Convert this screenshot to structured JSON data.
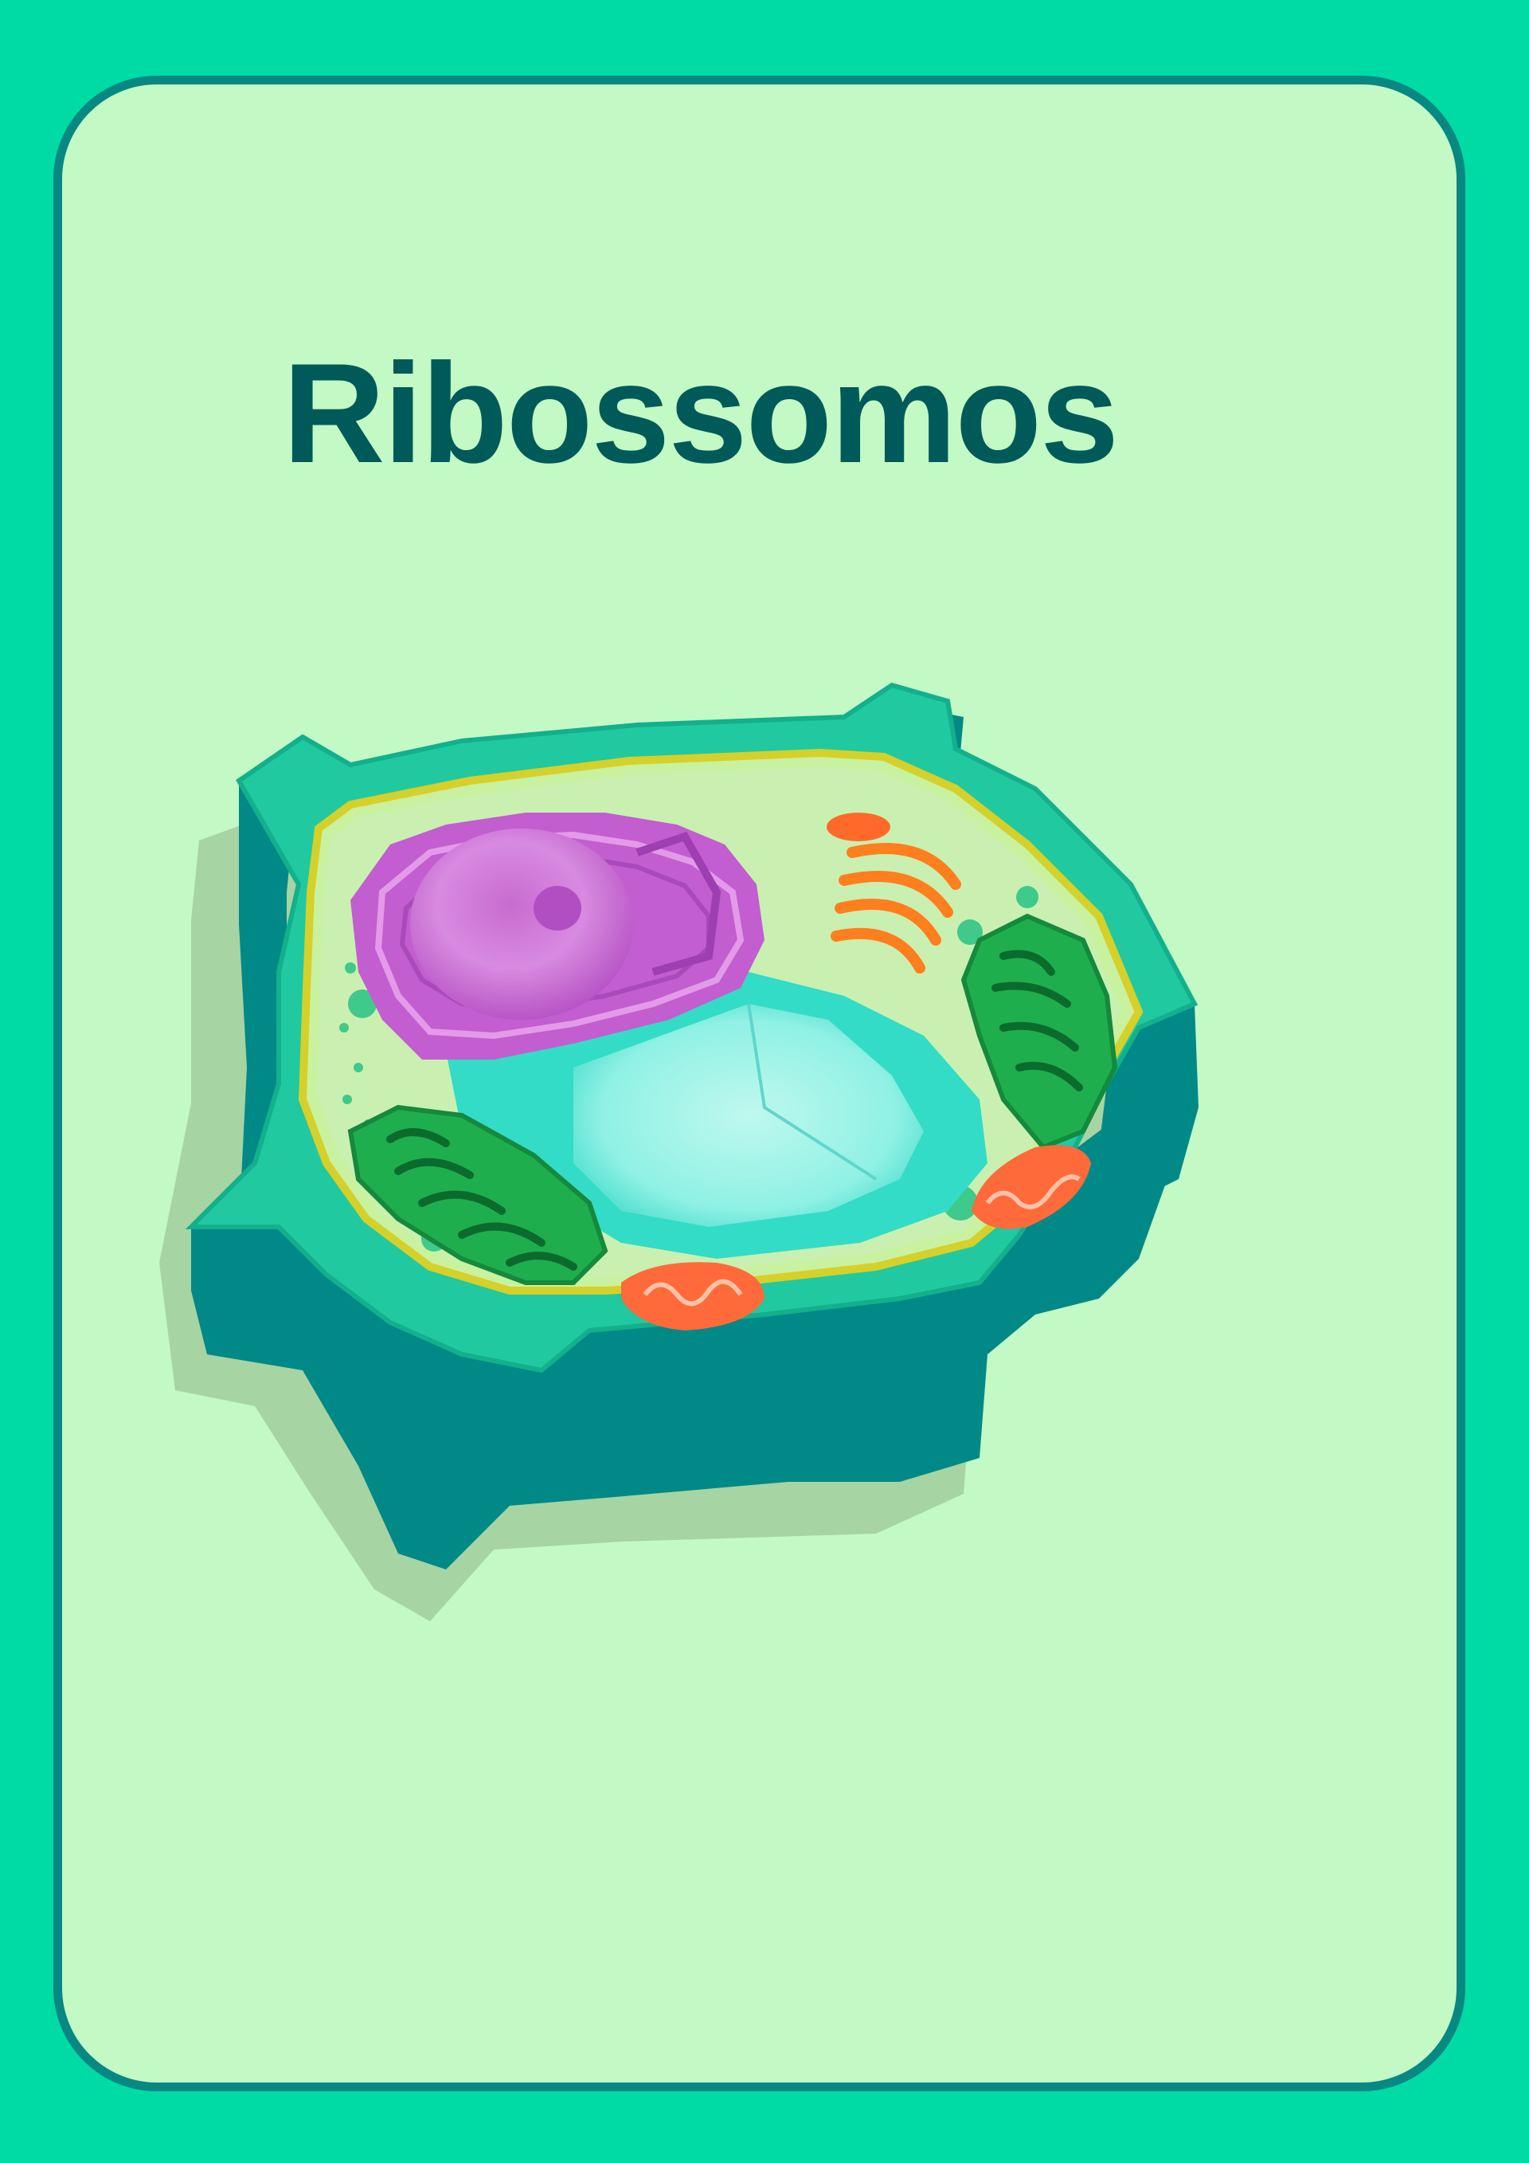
{
  "card": {
    "title": "Ribossomos",
    "background_color": "#c3f9c4",
    "border_color": "#078882",
    "page_color": "#00dba5",
    "title_color": "#005a59"
  },
  "illustration": {
    "subject": "plant-cell",
    "parts": [
      "cell-wall",
      "cell-membrane",
      "cytoplasm",
      "nucleus",
      "vacuole",
      "chloroplast",
      "mitochondrion",
      "golgi-apparatus",
      "ribosomes"
    ]
  }
}
